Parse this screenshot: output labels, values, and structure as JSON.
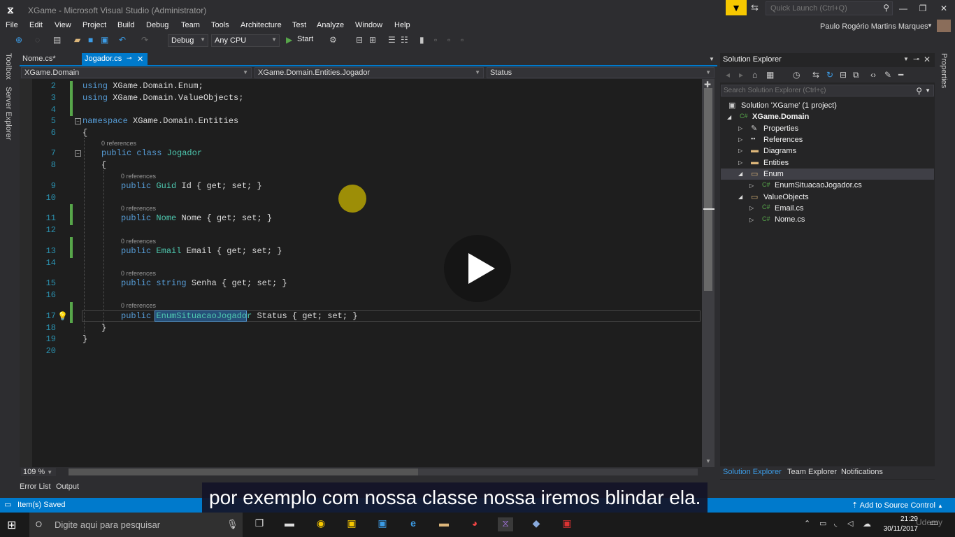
{
  "window": {
    "title": "XGame - Microsoft Visual Studio  (Administrator)",
    "user": "Paulo Rogério Martins Marques"
  },
  "quick_launch": {
    "placeholder": "Quick Launch (Ctrl+Q)"
  },
  "menu": [
    "File",
    "Edit",
    "View",
    "Project",
    "Build",
    "Debug",
    "Team",
    "Tools",
    "Architecture",
    "Test",
    "Analyze",
    "Window",
    "Help"
  ],
  "toolbar": {
    "config": "Debug",
    "platform": "Any CPU",
    "start": "Start"
  },
  "left_strip": {
    "toolbox": "Toolbox",
    "server_explorer": "Server Explorer"
  },
  "right_strip": {
    "properties": "Properties"
  },
  "tabs": [
    {
      "label": "Nome.cs*"
    },
    {
      "label": "Jogador.cs"
    }
  ],
  "navbar": {
    "project": "XGame.Domain",
    "type": "XGame.Domain.Entities.Jogador",
    "member": "Status"
  },
  "code": {
    "line_numbers": [
      "2",
      "3",
      "4",
      "5",
      "6",
      "7",
      "8",
      "9",
      "10",
      "11",
      "12",
      "13",
      "14",
      "15",
      "16",
      "17",
      "18",
      "19",
      "20"
    ],
    "refs": "0 references",
    "using1_kw": "using",
    "using1_ns": "XGame.Domain.Enum;",
    "using2_kw": "using",
    "using2_ns": "XGame.Domain.ValueObjects;",
    "ns_kw": "namespace",
    "ns_name": "XGame.Domain.Entities",
    "brace_open": "{",
    "brace_close": "}",
    "class_kw": "public class",
    "class_name": "Jogador",
    "p1_kw": "public",
    "p1_type": "Guid",
    "p1_rest": "Id { get; set; }",
    "p2_kw": "public",
    "p2_type": "Nome",
    "p2_rest": "Nome { get; set; }",
    "p3_kw": "public",
    "p3_type": "Email",
    "p3_rest": "Email { get; set; }",
    "p4_kw": "public",
    "p4_type": "string",
    "p4_rest": "Senha { get; set; }",
    "p5_kw": "public",
    "p5_type": "EnumSituacaoJogador",
    "p5_rest": "Status { get; set; }"
  },
  "zoom": "109 %",
  "bottom_tabs": [
    "Error List",
    "Output"
  ],
  "solution_explorer": {
    "title": "Solution Explorer",
    "search_placeholder": "Search Solution Explorer (Ctrl+ç)",
    "tree": [
      {
        "label": "Solution 'XGame' (1 project)",
        "icon": "solution-icon"
      },
      {
        "label": "XGame.Domain",
        "icon": "csproj-icon"
      },
      {
        "label": "Properties",
        "icon": "wrench-icon"
      },
      {
        "label": "References",
        "icon": "references-icon"
      },
      {
        "label": "Diagrams",
        "icon": "folder-icon"
      },
      {
        "label": "Entities",
        "icon": "folder-icon"
      },
      {
        "label": "Enum",
        "icon": "folder-open-icon"
      },
      {
        "label": "EnumSituacaoJogador.cs",
        "icon": "cs-file-icon"
      },
      {
        "label": "ValueObjects",
        "icon": "folder-open-icon"
      },
      {
        "label": "Email.cs",
        "icon": "cs-file-icon"
      },
      {
        "label": "Nome.cs",
        "icon": "cs-file-icon"
      }
    ],
    "bottom_tabs": [
      "Solution Explorer",
      "Team Explorer",
      "Notifications"
    ]
  },
  "status": {
    "text": "Item(s) Saved",
    "source_control": "Add to Source Control"
  },
  "subtitle": "por exemplo com nossa classe nossa iremos blindar ela.",
  "taskbar": {
    "search_placeholder": "Digite aqui para pesquisar",
    "time": "21:29",
    "date": "30/11/2017",
    "watermark": "Udemy"
  },
  "colors": {
    "accent": "#007acc",
    "editor_bg": "#1e1e1e",
    "keyword": "#569cd6",
    "type": "#4ec9b0"
  }
}
